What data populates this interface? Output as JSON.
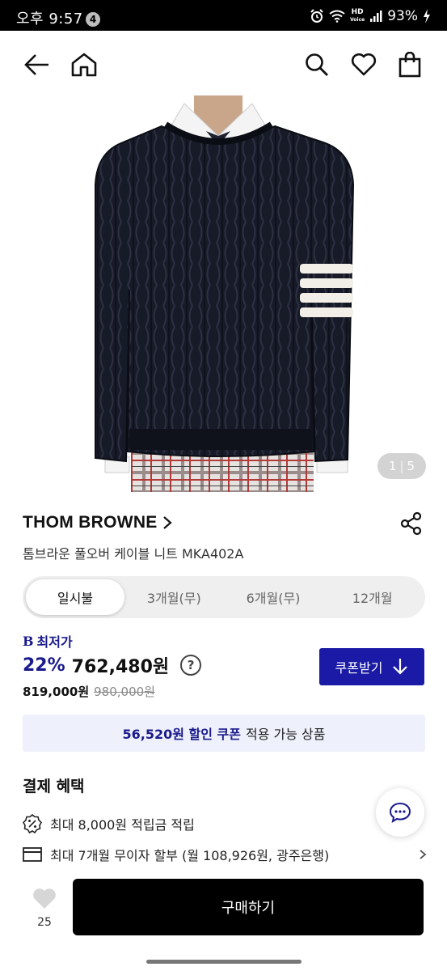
{
  "status_bar": {
    "time": "오후 9:57",
    "badge": "4",
    "battery": "93%",
    "hd_top": "HD",
    "hd_bottom": "Voice"
  },
  "product": {
    "brand": "THOM BROWNE",
    "name": "톰브라운 풀오버 케이블 니트 MKA402A",
    "image_pager": {
      "current": "1",
      "separator": "|",
      "total": "5"
    }
  },
  "payment_tabs": [
    {
      "label": "일시불",
      "active": true
    },
    {
      "label": "3개월(무)",
      "active": false
    },
    {
      "label": "6개월(무)",
      "active": false
    },
    {
      "label": "12개월",
      "active": false
    }
  ],
  "pricing": {
    "lowest_mark": "B",
    "lowest_label": "최저가",
    "discount": "22%",
    "price": "762,480원",
    "help": "?",
    "sale_price": "819,000원",
    "original_price": "980,000원"
  },
  "coupon_button": {
    "label": "쿠폰받기"
  },
  "coupon_banner": {
    "highlight": "56,520원 할인 쿠폰",
    "rest": "적용 가능 상품"
  },
  "benefits": {
    "title": "결제 혜택",
    "items": [
      {
        "icon": "percent-badge-icon",
        "text": "최대 8,000원 적립금 적립"
      },
      {
        "icon": "card-icon",
        "text": "최대 7개월 무이자 할부 (월 108,926원, 광주은행)"
      }
    ]
  },
  "bottom_bar": {
    "like_count": "25",
    "buy_label": "구매하기"
  },
  "colors": {
    "accent": "#1a1aa6",
    "accent_text": "#1a1a8c",
    "banner_bg": "#eef1fb",
    "buy_bg": "#000000"
  }
}
